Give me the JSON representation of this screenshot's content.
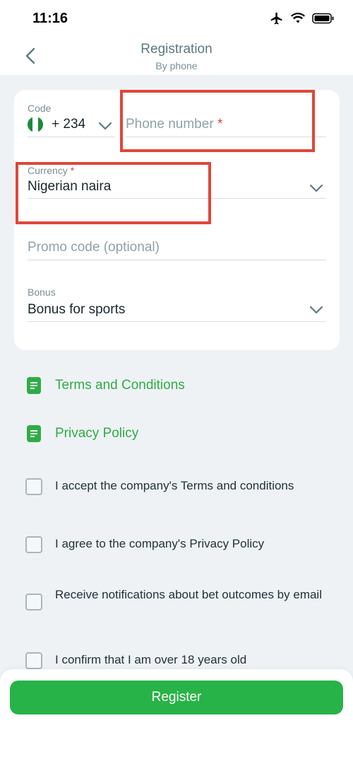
{
  "status_bar": {
    "time": "11:16"
  },
  "header": {
    "title": "Registration",
    "subtitle": "By phone",
    "back_icon": "chevron-left-icon"
  },
  "form": {
    "code_label": "Code",
    "code_value": "+ 234",
    "phone_placeholder": "Phone number",
    "required_mark": "*",
    "currency_label": "Currency",
    "currency_value": "Nigerian naira",
    "promo_placeholder": "Promo code (optional)",
    "bonus_label": "Bonus",
    "bonus_value": "Bonus for sports"
  },
  "links": [
    {
      "label": "Terms and Conditions",
      "icon": "document-icon"
    },
    {
      "label": "Privacy Policy",
      "icon": "document-icon"
    }
  ],
  "checkboxes": [
    {
      "label": "I accept the company's Terms and conditions",
      "checked": false
    },
    {
      "label": "I agree to the company's Privacy Policy",
      "checked": false
    },
    {
      "label": "Receive notifications about bet outcomes by email",
      "checked": false
    },
    {
      "label": "I confirm that I am over 18 years old",
      "checked": false
    }
  ],
  "register_label": "Register",
  "colors": {
    "accent": "#27b347",
    "annotation": "#e0463a",
    "header_text": "#5a7a82"
  }
}
